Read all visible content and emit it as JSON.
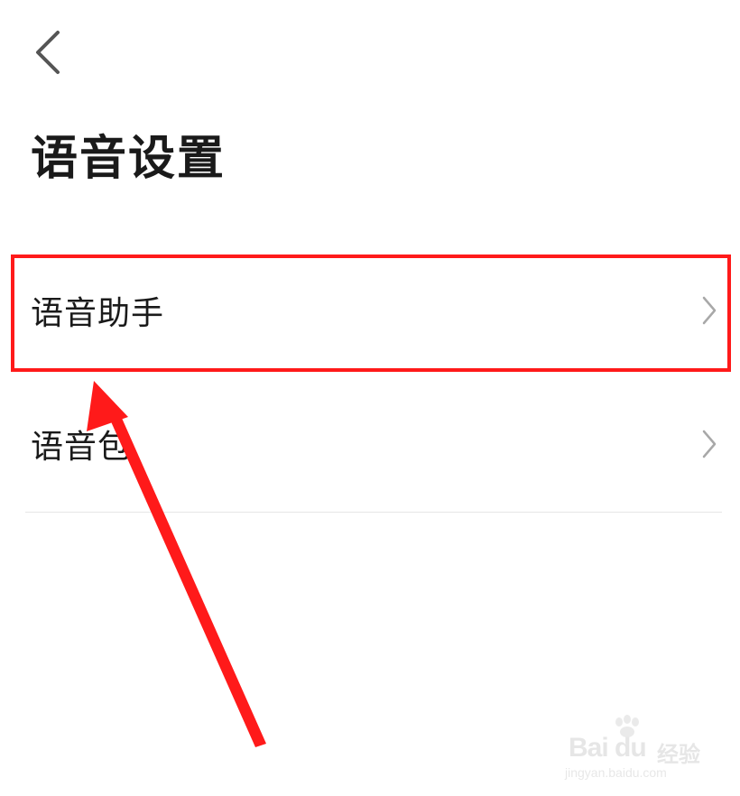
{
  "header": {
    "back_icon": "chevron-left-icon"
  },
  "page": {
    "title": "语音设置"
  },
  "settings": {
    "items": [
      {
        "label": "语音助手",
        "icon": "chevron-right-icon"
      },
      {
        "label": "语音包",
        "icon": "chevron-right-icon"
      }
    ]
  },
  "annotation": {
    "highlight_color": "#ff1a1a",
    "arrow_color": "#ff1a1a"
  },
  "watermark": {
    "brand": "Bai du",
    "suffix": "经验",
    "url": "jingyan.baidu.com"
  }
}
